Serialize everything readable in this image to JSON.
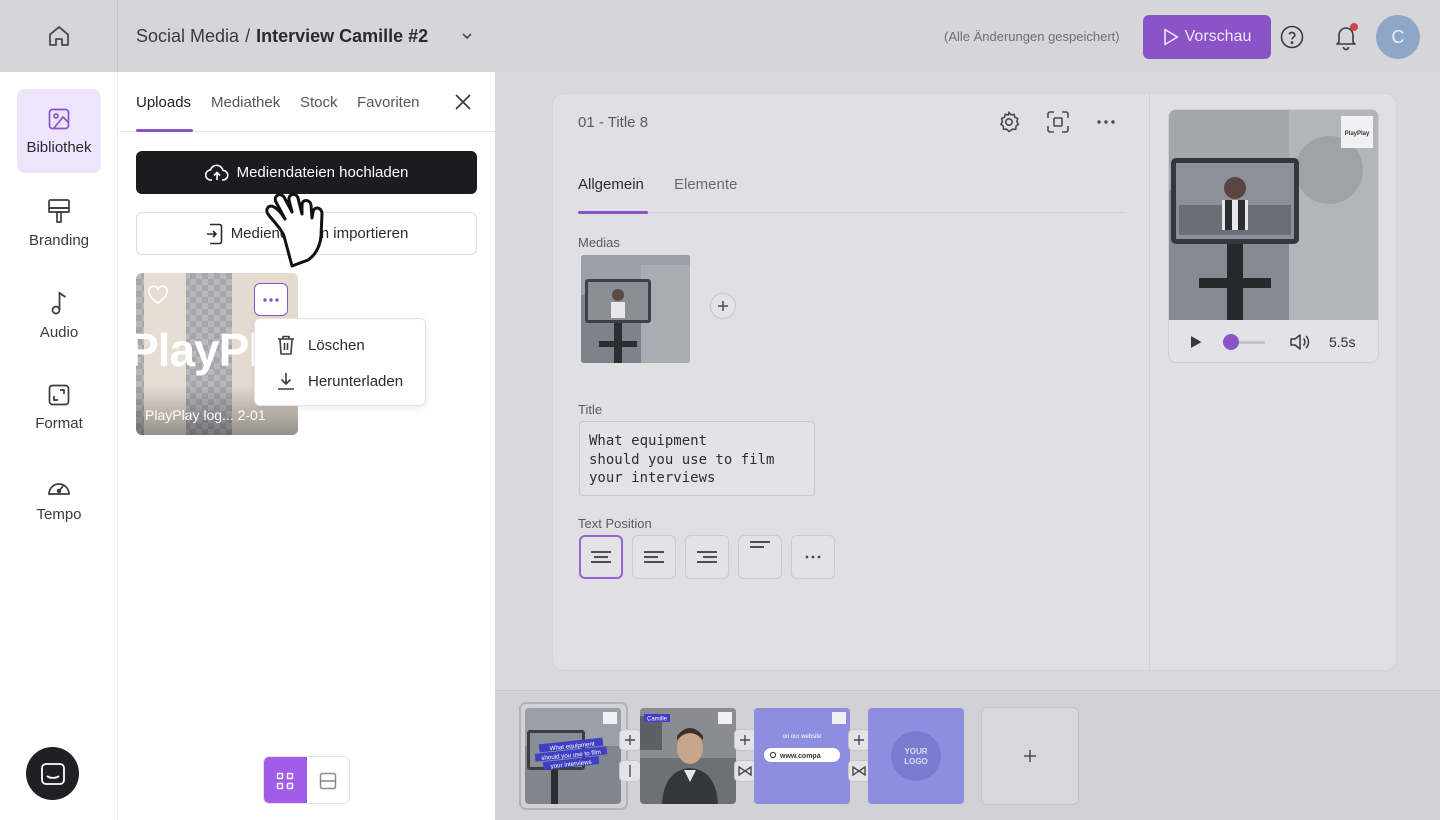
{
  "topbar": {
    "breadcrumb_root": "Social Media",
    "breadcrumb_sep": "/",
    "project_name": "Interview Camille #2",
    "saved_status": "(Alle Änderungen gespeichert)",
    "preview_label": "Vorschau",
    "avatar_initial": "C"
  },
  "rail": {
    "items": [
      {
        "label": "Bibliothek",
        "icon": "image-icon",
        "active": true
      },
      {
        "label": "Branding",
        "icon": "paint-roller-icon"
      },
      {
        "label": "Audio",
        "icon": "music-note-icon"
      },
      {
        "label": "Format",
        "icon": "resize-icon"
      },
      {
        "label": "Tempo",
        "icon": "speedometer-icon"
      }
    ]
  },
  "library": {
    "tabs": [
      "Uploads",
      "Mediathek",
      "Stock",
      "Favoriten"
    ],
    "active_tab": "Uploads",
    "upload_label": "Mediendateien hochladen",
    "import_label": "Mediendateien importieren",
    "media_item": {
      "name": "PlayPlay log... 2-01",
      "thumb_text": "PlayPl"
    },
    "context_menu": {
      "delete": "Löschen",
      "download": "Herunterladen"
    }
  },
  "editor": {
    "slide_title": "01 - Title 8",
    "tabs": [
      "Allgemein",
      "Elemente"
    ],
    "active_tab": "Allgemein",
    "medias_label": "Medias",
    "title_label": "Title",
    "title_value": "What equipment\nshould you use to film\nyour interviews",
    "text_position_label": "Text Position"
  },
  "preview": {
    "duration": "5.5s",
    "logo_text": "PlayPlay",
    "progress": 0
  },
  "timeline": {
    "slide1_text": "What equipment should you use to film your interviews",
    "slide2_tag": "Camille",
    "slide3_text": "on our website",
    "slide3_url": "www.compa",
    "slide4_text": "YOUR LOGO"
  },
  "colors": {
    "accent": "#8a54c8",
    "accent_light": "#eee4fb",
    "dark": "#1b1b20",
    "slide_purple": "#8e8ee0"
  }
}
